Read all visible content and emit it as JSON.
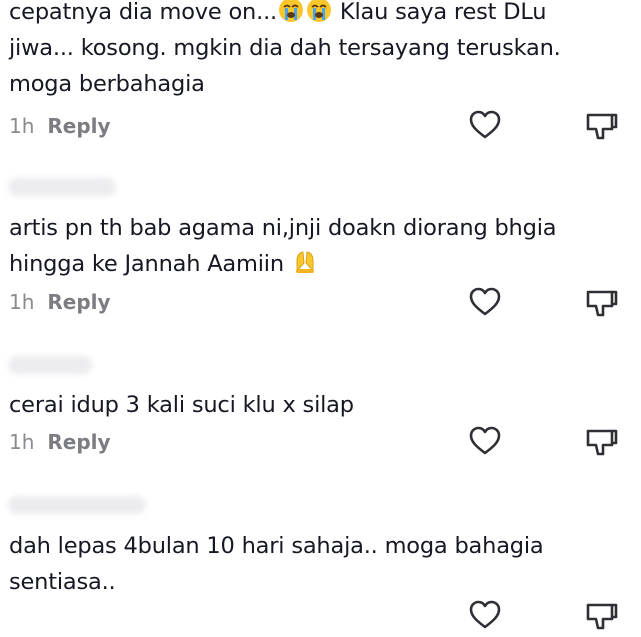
{
  "comments": [
    {
      "text_parts": [
        "cepatnya dia move on...",
        " Klau saya rest DLu jiwa... kosong. mgkin dia dah tersayang teruskan. moga berbahagia"
      ],
      "emoji": [
        "crying-face",
        "crying-face"
      ],
      "time": "1h",
      "reply_label": "Reply"
    },
    {
      "text": "artis pn th bab agama ni,jnji doakn diorang bhgia hingga ke Jannah Aamiin",
      "emoji": [
        "folded-hands"
      ],
      "time": "1h",
      "reply_label": "Reply"
    },
    {
      "text": "cerai idup 3 kali suci klu x silap",
      "time": "1h",
      "reply_label": "Reply"
    },
    {
      "text": "dah lepas 4bulan 10 hari sahaja.. moga bahagia sentiasa.."
    }
  ],
  "icons": {
    "like": "heart-icon",
    "dislike": "thumbs-down-icon"
  },
  "colors": {
    "text": "#161823",
    "meta": "#8a8b91",
    "icon": "#2f3036",
    "emoji_yellow": "#f9c72b"
  }
}
